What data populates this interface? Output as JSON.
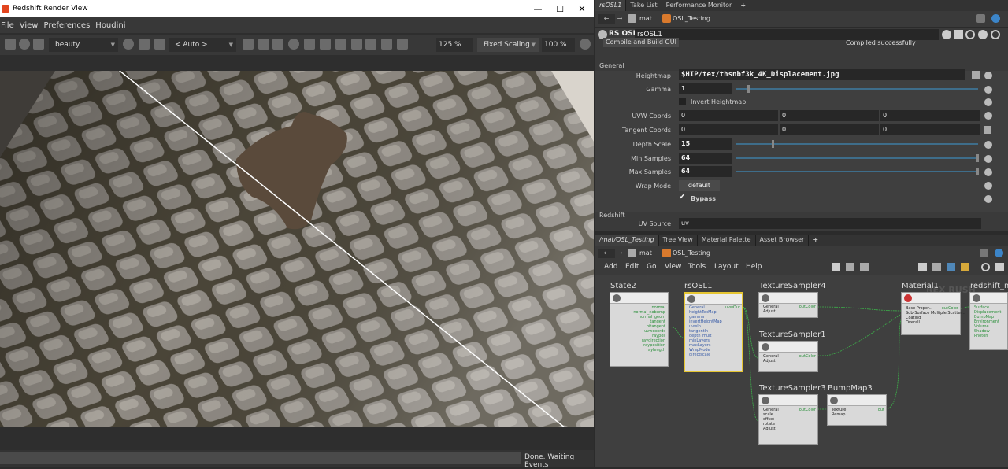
{
  "render_view": {
    "title": "Redshift Render View",
    "menu": [
      "File",
      "View",
      "Preferences",
      "Houdini"
    ],
    "aov": "beauty",
    "camera": "< Auto >",
    "zoom": "125 %",
    "scaling": "Fixed Scaling",
    "scaling_percent": "100 %",
    "status": "Done. Waiting Events"
  },
  "parm_pane": {
    "tabs": [
      "rsOSL1",
      "Take List",
      "Performance Monitor"
    ],
    "path": [
      "mat",
      "OSL_Testing"
    ],
    "node_type": "RS OSL",
    "node_name": "rsOSL1",
    "compile_button": "Compile and Build GUI",
    "compile_status": "Compiled successfully",
    "sections": {
      "general": "General",
      "redshift": "Redshift"
    },
    "heightmap_label": "Heightmap",
    "heightmap_value": "$HIP/tex/thsnbf3k_4K_Displacement.jpg",
    "gamma_label": "Gamma",
    "gamma_value": "1",
    "gamma_fraction": 0.05,
    "invert_label": "Invert Heightmap",
    "uvw_label": "UVW Coords",
    "uvw_values": [
      "0",
      "0",
      "0"
    ],
    "tangent_label": "Tangent Coords",
    "tangent_values": [
      "0",
      "0",
      "0"
    ],
    "depth_label": "Depth Scale",
    "depth_value": "15",
    "depth_fraction": 0.15,
    "min_label": "Min Samples",
    "min_value": "64",
    "max_label": "Max Samples",
    "max_value": "64",
    "wrap_label": "Wrap Mode",
    "wrap_value": "default",
    "bypass_label": "Bypass",
    "uv_source_label": "UV Source",
    "uv_source_value": "uv"
  },
  "network_pane": {
    "tabs": [
      "/mat/OSL_Testing",
      "Tree View",
      "Material Palette",
      "Asset Browser"
    ],
    "path": [
      "mat",
      "OSL_Testing"
    ],
    "menu": [
      "Add",
      "Edit",
      "Go",
      "View",
      "Tools",
      "Layout",
      "Help"
    ],
    "watermark": "REX RUSH",
    "nodes": {
      "state": {
        "title": "State2",
        "outputs": [
          "normal",
          "normal_nobump",
          "normal_geom",
          "tangent",
          "bitangent",
          "uvwcoords",
          "raypos",
          "raydirection",
          "rayposition",
          "raylength"
        ]
      },
      "osl": {
        "title": "rsOSL1",
        "inputs": [
          "General",
          "heightTexMap",
          "gamma",
          "invertHeightMap",
          "uvwIn",
          "tangentIn",
          "depth_mult",
          "minLayers",
          "maxLayers",
          "WrapMode",
          "directscale"
        ],
        "output": "uvwOut"
      },
      "ts4": {
        "title": "TextureSampler4",
        "inputs": [
          "General",
          "Adjust"
        ],
        "output": "outColor"
      },
      "ts1": {
        "title": "TextureSampler1",
        "inputs": [
          "General",
          "Adjust"
        ],
        "output": "outColor"
      },
      "ts3": {
        "title": "TextureSampler3",
        "inputs": [
          "General",
          "scale",
          "offset",
          "rotate",
          "Adjust"
        ],
        "output": "outColor"
      },
      "bump": {
        "title": "BumpMap3",
        "inputs": [
          "Texture",
          "Remap"
        ],
        "output": "out"
      },
      "material": {
        "title": "Material1",
        "inputs": [
          "Base Proper...",
          "Sub-Surface Multiple Scatter...",
          "Coating",
          "Overall"
        ],
        "output": "outColor"
      },
      "rsout": {
        "title": "redshift_m",
        "inputs": [
          "Surface",
          "Displacement",
          "BumpMap",
          "Environment",
          "Volume",
          "Shadow",
          "Photon"
        ]
      }
    }
  },
  "colors": {
    "accent": "#4f87b8",
    "selected_node": "#e5c532",
    "wire": "#3cb44a"
  }
}
